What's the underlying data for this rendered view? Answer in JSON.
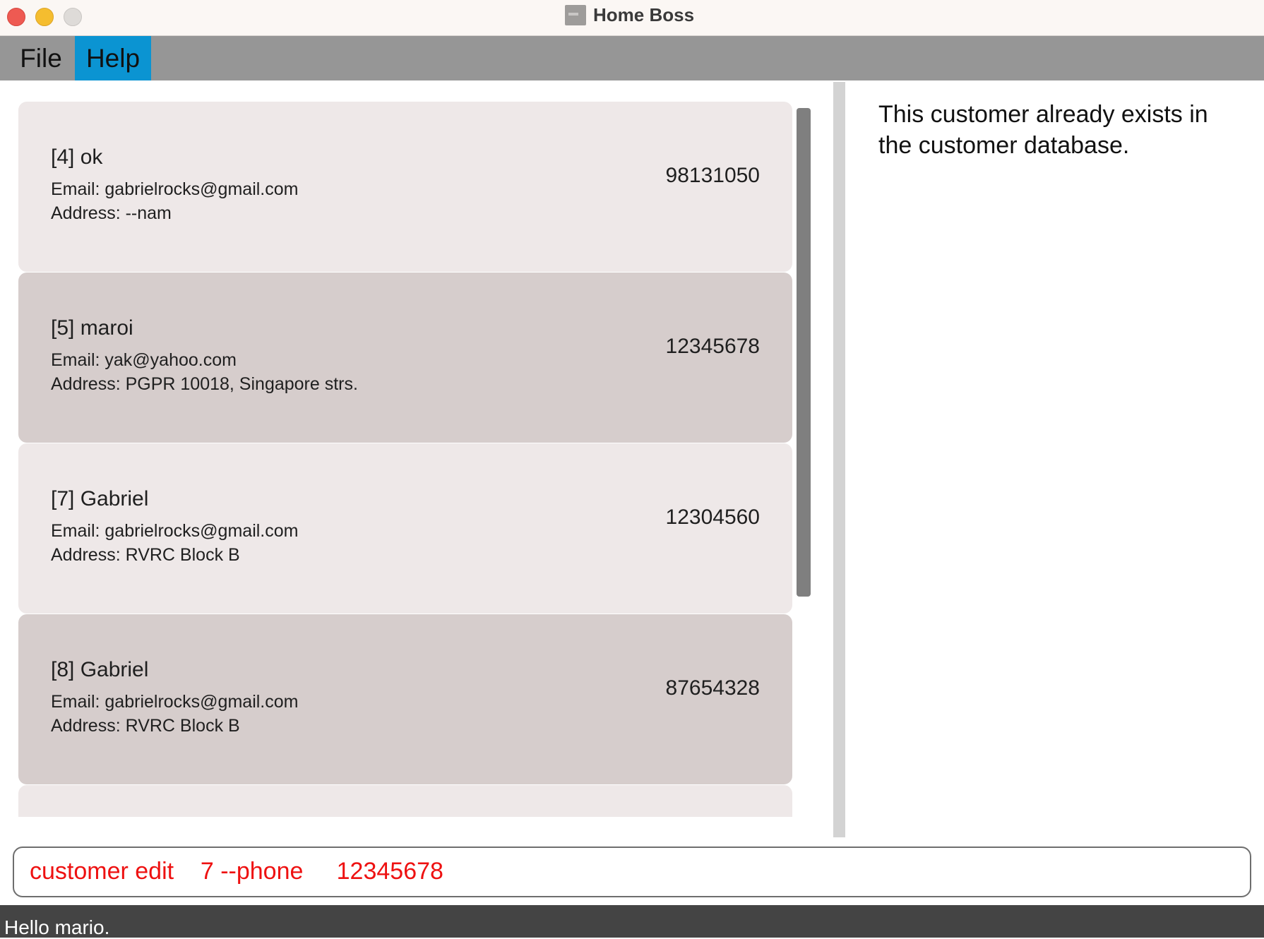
{
  "window": {
    "title": "Home Boss"
  },
  "menu": {
    "items": [
      {
        "label": "File"
      },
      {
        "label": "Help"
      }
    ]
  },
  "customers": [
    {
      "name": "[4] ok",
      "email": "Email: gabrielrocks@gmail.com",
      "address": "Address: --nam",
      "phone": "98131050"
    },
    {
      "name": "[5] maroi",
      "email": "Email: yak@yahoo.com",
      "address": "Address: PGPR 10018, Singapore strs.",
      "phone": "12345678"
    },
    {
      "name": "[7] Gabriel",
      "email": "Email: gabrielrocks@gmail.com",
      "address": "Address: RVRC Block B",
      "phone": "12304560"
    },
    {
      "name": "[8] Gabriel",
      "email": "Email: gabrielrocks@gmail.com",
      "address": "Address: RVRC Block B",
      "phone": "87654328"
    }
  ],
  "result": {
    "message": "This customer already exists in the customer database."
  },
  "command": {
    "value": "customer edit    7 --phone     12345678",
    "color": "#ee1111"
  },
  "status": {
    "text": "Hello mario."
  }
}
